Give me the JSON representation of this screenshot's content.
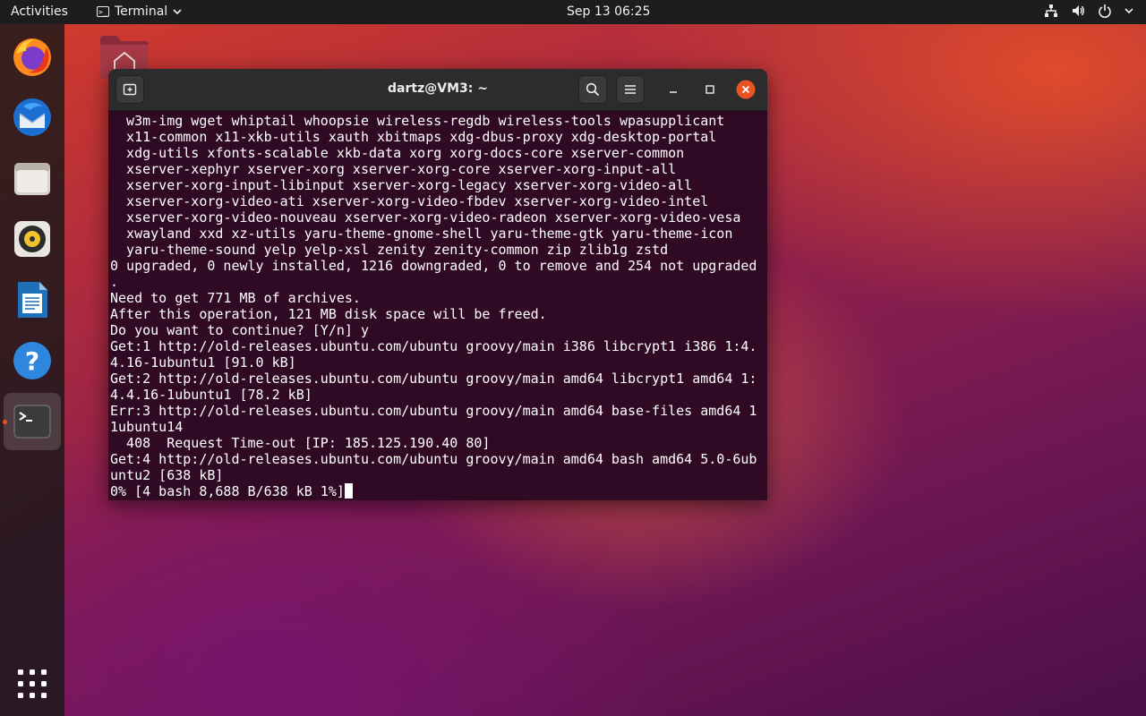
{
  "topbar": {
    "activities": "Activities",
    "app_name": "Terminal",
    "clock": "Sep 13  06:25",
    "tray_icons": [
      "network-icon",
      "volume-icon",
      "power-icon"
    ]
  },
  "dock": {
    "items": [
      {
        "name": "firefox",
        "icon": "firefox-icon"
      },
      {
        "name": "thunderbird",
        "icon": "thunderbird-icon"
      },
      {
        "name": "files",
        "icon": "files-icon"
      },
      {
        "name": "rhythmbox",
        "icon": "rhythmbox-icon"
      },
      {
        "name": "libreoffice-writer",
        "icon": "writer-icon"
      },
      {
        "name": "help",
        "icon": "help-icon"
      },
      {
        "name": "terminal",
        "icon": "terminal-icon",
        "active": true
      }
    ],
    "show_apps_icon": "app-grid-icon"
  },
  "desktop": {
    "home_folder_icon": "home-folder-icon"
  },
  "terminal": {
    "title": "dartz@VM3: ~",
    "lines": [
      "  w3m-img wget whiptail whoopsie wireless-regdb wireless-tools wpasupplicant",
      "  x11-common x11-xkb-utils xauth xbitmaps xdg-dbus-proxy xdg-desktop-portal",
      "  xdg-utils xfonts-scalable xkb-data xorg xorg-docs-core xserver-common",
      "  xserver-xephyr xserver-xorg xserver-xorg-core xserver-xorg-input-all",
      "  xserver-xorg-input-libinput xserver-xorg-legacy xserver-xorg-video-all",
      "  xserver-xorg-video-ati xserver-xorg-video-fbdev xserver-xorg-video-intel",
      "  xserver-xorg-video-nouveau xserver-xorg-video-radeon xserver-xorg-video-vesa",
      "  xwayland xxd xz-utils yaru-theme-gnome-shell yaru-theme-gtk yaru-theme-icon",
      "  yaru-theme-sound yelp yelp-xsl zenity zenity-common zip zlib1g zstd",
      "0 upgraded, 0 newly installed, 1216 downgraded, 0 to remove and 254 not upgraded",
      ".",
      "Need to get 771 MB of archives.",
      "After this operation, 121 MB disk space will be freed.",
      "Do you want to continue? [Y/n] y",
      "Get:1 http://old-releases.ubuntu.com/ubuntu groovy/main i386 libcrypt1 i386 1:4.",
      "4.16-1ubuntu1 [91.0 kB]",
      "Get:2 http://old-releases.ubuntu.com/ubuntu groovy/main amd64 libcrypt1 amd64 1:",
      "4.4.16-1ubuntu1 [78.2 kB]",
      "Err:3 http://old-releases.ubuntu.com/ubuntu groovy/main amd64 base-files amd64 1",
      "1ubuntu14",
      "  408  Request Time-out [IP: 185.125.190.40 80]",
      "Get:4 http://old-releases.ubuntu.com/ubuntu groovy/main amd64 bash amd64 5.0-6ub",
      "untu2 [638 kB]",
      "0% [4 bash 8,688 B/638 kB 1%]"
    ]
  },
  "colors": {
    "accent": "#e95420",
    "terminal_bg": "#300a24",
    "titlebar_bg": "#2c2c2c",
    "close_button": "#e95420"
  }
}
